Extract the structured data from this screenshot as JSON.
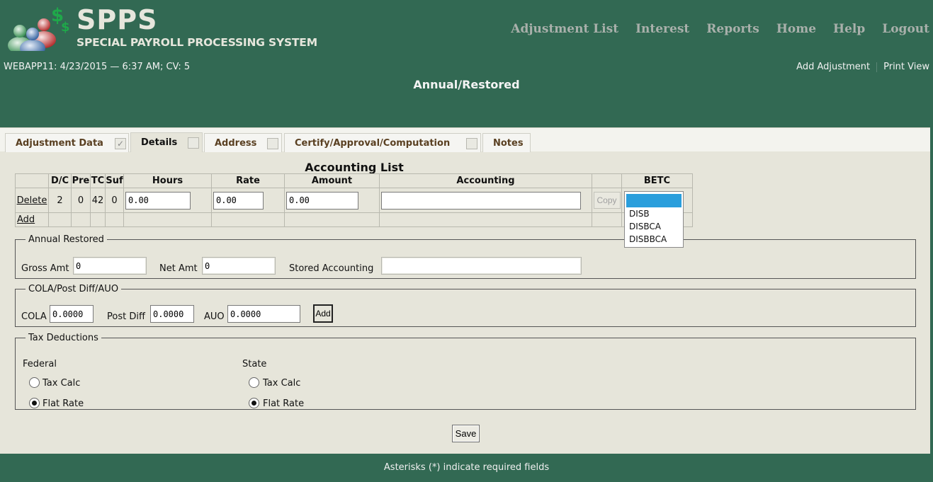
{
  "app": {
    "name": "SPPS",
    "subtitle": "SPECIAL PAYROLL PROCESSING SYSTEM",
    "status_line": "WEBAPP11: 4/23/2015 — 6:37 AM; CV: 5",
    "page_title": "Annual/Restored"
  },
  "topnav": [
    "Adjustment List",
    "Interest",
    "Reports",
    "Home",
    "Help",
    "Logout"
  ],
  "subnav": {
    "add_adjustment": "Add Adjustment",
    "print_view": "Print View"
  },
  "tabs": [
    {
      "label": "Adjustment Data",
      "checked": true,
      "check_glyph": "✓"
    },
    {
      "label": "Details",
      "checked": false,
      "check_glyph": ""
    },
    {
      "label": "Address",
      "checked": false,
      "check_glyph": ""
    },
    {
      "label": "Certify/Approval/Computation",
      "checked": false,
      "check_glyph": ""
    },
    {
      "label": "Notes"
    }
  ],
  "accounting": {
    "title": "Accounting List",
    "headers": [
      "",
      "D/C",
      "Pre",
      "TC",
      "Suf",
      "Hours",
      "Rate",
      "Amount",
      "Accounting",
      "",
      "BETC"
    ],
    "row": {
      "delete_label": "Delete",
      "dc": "2",
      "pre": "0",
      "tc": "42",
      "suf": "0",
      "hours": "0.00",
      "rate": "0.00",
      "amount": "0.00",
      "accounting": "",
      "copy_label": "Copy"
    },
    "add_label": "Add",
    "betc_options": [
      "",
      "DISB",
      "DISBCA",
      "DISBBCA"
    ],
    "betc_selected": ""
  },
  "annual_restored": {
    "legend": "Annual Restored",
    "gross_label": "Gross Amt",
    "gross_value": "0",
    "net_label": "Net Amt",
    "net_value": "0",
    "stored_label": "Stored Accounting",
    "stored_value": ""
  },
  "cola": {
    "legend": "COLA/Post Diff/AUO",
    "cola_label": "COLA",
    "cola_value": "0.0000",
    "postdiff_label": "Post Diff",
    "postdiff_value": "0.0000",
    "auo_label": "AUO",
    "auo_value": "0.0000",
    "add_label": "Add"
  },
  "tax": {
    "legend": "Tax Deductions",
    "federal_label": "Federal",
    "state_label": "State",
    "tax_calc_label": "Tax Calc",
    "flat_rate_label": "Flat Rate",
    "federal_selected": "Flat Rate",
    "state_selected": "Flat Rate"
  },
  "save_label": "Save",
  "footer": "Asterisks (*) indicate required fields"
}
